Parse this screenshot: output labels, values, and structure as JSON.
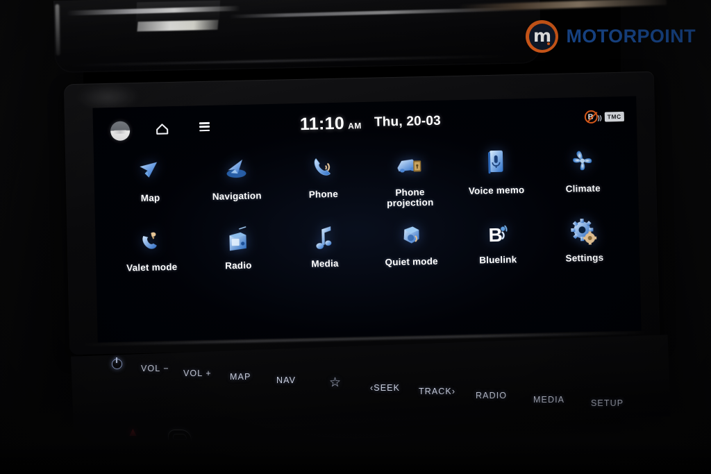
{
  "brand": {
    "logo_text": "MOTORPOINT",
    "logo_letter": "m",
    "ring_color": "#e2601b",
    "text_color": "#1b4f9c"
  },
  "screen": {
    "status_bar": {
      "avatar": "user-avatar",
      "home_icon": "home-icon",
      "menu_icon": "menu-icon",
      "time": "11:10",
      "meridiem": "AM",
      "date": "Thu, 20-03",
      "bluelink_disabled_icon": "bluelink-disabled-icon",
      "bluelink_letter": "B",
      "tmc_badge": "TMC"
    },
    "apps": [
      {
        "label": "Map",
        "icon": "map-arrow-icon"
      },
      {
        "label": "Navigation",
        "icon": "navigation-icon"
      },
      {
        "label": "Phone",
        "icon": "phone-handset-icon"
      },
      {
        "label": "Phone\nprojection",
        "icon": "phone-projection-icon"
      },
      {
        "label": "Voice memo",
        "icon": "microphone-icon"
      },
      {
        "label": "Climate",
        "icon": "fan-icon"
      },
      {
        "label": "Valet mode",
        "icon": "valet-key-icon"
      },
      {
        "label": "Radio",
        "icon": "radio-icon"
      },
      {
        "label": "Media",
        "icon": "music-note-icon"
      },
      {
        "label": "Quiet mode",
        "icon": "quiet-speaker-icon"
      },
      {
        "label": "Bluelink",
        "icon": "bluelink-icon"
      },
      {
        "label": "Settings",
        "icon": "gears-icon"
      }
    ]
  },
  "hard_keys": [
    {
      "label": "VOL −",
      "name": "volume-down-key"
    },
    {
      "label": "VOL +",
      "name": "volume-up-key"
    },
    {
      "label": "MAP",
      "name": "map-key"
    },
    {
      "label": "NAV",
      "name": "nav-key"
    },
    {
      "label": "‹SEEK",
      "name": "seek-key"
    },
    {
      "label": "TRACK›",
      "name": "track-key"
    },
    {
      "label": "RADIO",
      "name": "radio-key"
    },
    {
      "label": "MEDIA",
      "name": "media-key"
    },
    {
      "label": "SETUP",
      "name": "setup-key"
    }
  ],
  "power_key": "power-icon",
  "favorite_key": "☆",
  "climate_keys": {
    "temp_up": "▲",
    "temp_down": "▼"
  }
}
